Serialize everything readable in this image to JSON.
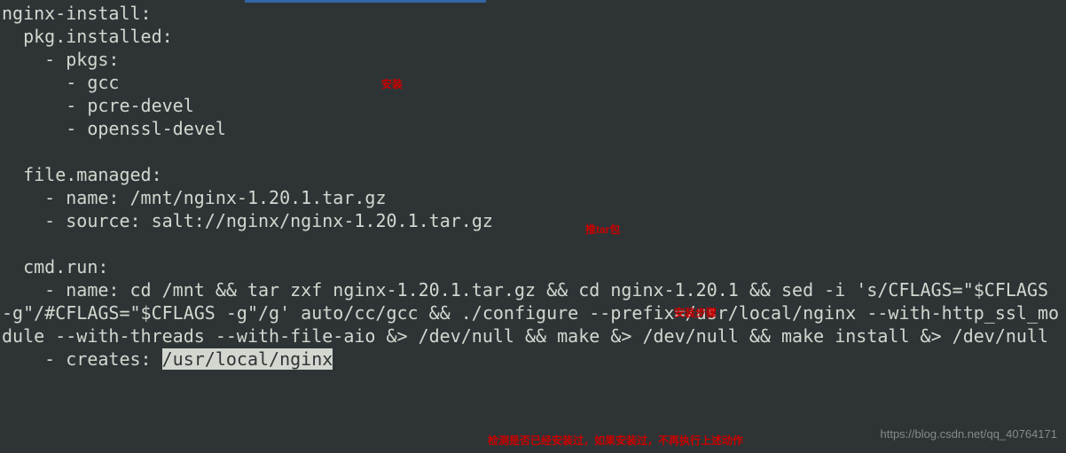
{
  "code": {
    "l01": "nginx-install:",
    "l02": "  pkg.installed:",
    "l03": "    - pkgs:",
    "l04": "      - gcc",
    "l05": "      - pcre-devel",
    "l06": "      - openssl-devel",
    "l07": "",
    "l08": "  file.managed:",
    "l09": "    - name: /mnt/nginx-1.20.1.tar.gz",
    "l10": "    - source: salt://nginx/nginx-1.20.1.tar.gz",
    "l11": "",
    "l12": "  cmd.run:",
    "l13": "    - name: cd /mnt && tar zxf nginx-1.20.1.tar.gz && cd nginx-1.20.1 && sed -i 's/CFLAGS=\"$CFLAGS -g\"/#CFLAGS=\"$CFLAGS -g\"/g' auto/cc/gcc && ./configure --prefix=/usr/local/nginx --with-http_ssl_module --with-threads --with-file-aio &> /dev/null && make &> /dev/null && make install &> /dev/null",
    "l14a": "    - creates: ",
    "l14b": "/usr/local/nginx"
  },
  "annotations": {
    "install": "安装",
    "tar": "推tar包",
    "steps": "安装步骤",
    "check": "检测是否已经安装过，如果安装过，不再执行上述动作"
  },
  "watermark": "https://blog.csdn.net/qq_40764171"
}
